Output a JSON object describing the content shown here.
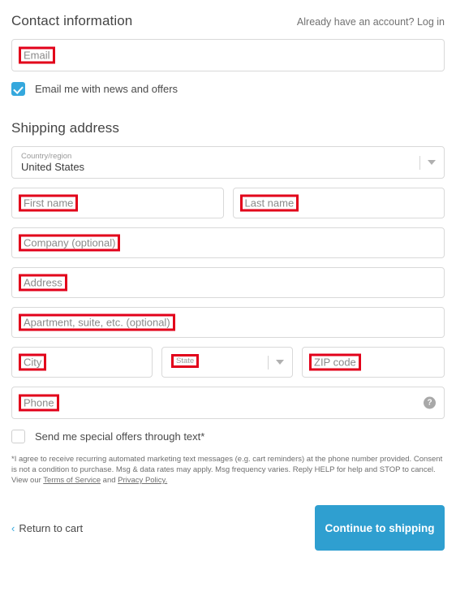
{
  "contact": {
    "title": "Contact information",
    "login_prompt": "Already have an account? Log in",
    "email_placeholder": "Email",
    "newsletter_label": "Email me with news and offers"
  },
  "shipping": {
    "title": "Shipping address",
    "country": {
      "label": "Country/region",
      "value": "United States"
    },
    "first_name_placeholder": "First name",
    "last_name_placeholder": "Last name",
    "company_placeholder": "Company (optional)",
    "address_placeholder": "Address",
    "apartment_placeholder": "Apartment, suite, etc. (optional)",
    "city_placeholder": "City",
    "state_label": "State",
    "zip_placeholder": "ZIP code",
    "phone_placeholder": "Phone",
    "phone_help_glyph": "?"
  },
  "sms": {
    "checkbox_label": "Send me special offers through text*",
    "disclaimer_part1": "*I agree to receive recurring automated marketing text messages (e.g. cart reminders) at the phone number provided. Consent is not a condition to purchase. Msg & data rates may apply. Msg frequency varies. Reply HELP for help and STOP to cancel. View our ",
    "terms_link": "Terms of Service",
    "disclaimer_part2": " and ",
    "privacy_link": "Privacy Policy.",
    "disclaimer_part3": ""
  },
  "footer": {
    "return_chevron": "‹",
    "return_label": "Return to cart",
    "continue_label": "Continue to shipping"
  },
  "colors": {
    "accent_blue": "#2f9fd0",
    "checkbox_blue": "#35a8dd",
    "annotation_red": "#e2001a",
    "border_gray": "#d9d9d9",
    "placeholder_gray": "#8a8a8a"
  }
}
